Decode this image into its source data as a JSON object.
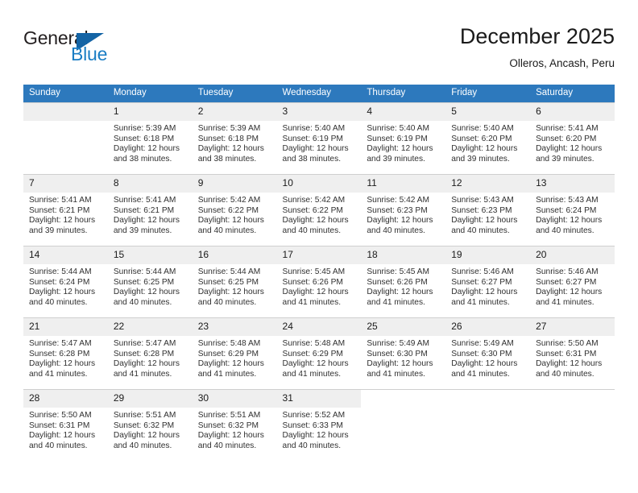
{
  "brand": {
    "name_part1": "General",
    "name_part2": "Blue",
    "triangle_icon": "triangle-icon",
    "colors": {
      "dark": "#231f20",
      "blue": "#1a7dc4",
      "triangle": "#1464a5"
    }
  },
  "header": {
    "title": "December 2025",
    "subtitle": "Olleros, Ancash, Peru"
  },
  "calendar": {
    "header_bg": "#2d79bd",
    "daynum_bg": "#efefef",
    "weekdays": [
      "Sunday",
      "Monday",
      "Tuesday",
      "Wednesday",
      "Thursday",
      "Friday",
      "Saturday"
    ],
    "weeks": [
      [
        {
          "day": "",
          "sunrise": "",
          "sunset": "",
          "daylight1": "",
          "daylight2": ""
        },
        {
          "day": "1",
          "sunrise": "Sunrise: 5:39 AM",
          "sunset": "Sunset: 6:18 PM",
          "daylight1": "Daylight: 12 hours",
          "daylight2": "and 38 minutes."
        },
        {
          "day": "2",
          "sunrise": "Sunrise: 5:39 AM",
          "sunset": "Sunset: 6:18 PM",
          "daylight1": "Daylight: 12 hours",
          "daylight2": "and 38 minutes."
        },
        {
          "day": "3",
          "sunrise": "Sunrise: 5:40 AM",
          "sunset": "Sunset: 6:19 PM",
          "daylight1": "Daylight: 12 hours",
          "daylight2": "and 38 minutes."
        },
        {
          "day": "4",
          "sunrise": "Sunrise: 5:40 AM",
          "sunset": "Sunset: 6:19 PM",
          "daylight1": "Daylight: 12 hours",
          "daylight2": "and 39 minutes."
        },
        {
          "day": "5",
          "sunrise": "Sunrise: 5:40 AM",
          "sunset": "Sunset: 6:20 PM",
          "daylight1": "Daylight: 12 hours",
          "daylight2": "and 39 minutes."
        },
        {
          "day": "6",
          "sunrise": "Sunrise: 5:41 AM",
          "sunset": "Sunset: 6:20 PM",
          "daylight1": "Daylight: 12 hours",
          "daylight2": "and 39 minutes."
        }
      ],
      [
        {
          "day": "7",
          "sunrise": "Sunrise: 5:41 AM",
          "sunset": "Sunset: 6:21 PM",
          "daylight1": "Daylight: 12 hours",
          "daylight2": "and 39 minutes."
        },
        {
          "day": "8",
          "sunrise": "Sunrise: 5:41 AM",
          "sunset": "Sunset: 6:21 PM",
          "daylight1": "Daylight: 12 hours",
          "daylight2": "and 39 minutes."
        },
        {
          "day": "9",
          "sunrise": "Sunrise: 5:42 AM",
          "sunset": "Sunset: 6:22 PM",
          "daylight1": "Daylight: 12 hours",
          "daylight2": "and 40 minutes."
        },
        {
          "day": "10",
          "sunrise": "Sunrise: 5:42 AM",
          "sunset": "Sunset: 6:22 PM",
          "daylight1": "Daylight: 12 hours",
          "daylight2": "and 40 minutes."
        },
        {
          "day": "11",
          "sunrise": "Sunrise: 5:42 AM",
          "sunset": "Sunset: 6:23 PM",
          "daylight1": "Daylight: 12 hours",
          "daylight2": "and 40 minutes."
        },
        {
          "day": "12",
          "sunrise": "Sunrise: 5:43 AM",
          "sunset": "Sunset: 6:23 PM",
          "daylight1": "Daylight: 12 hours",
          "daylight2": "and 40 minutes."
        },
        {
          "day": "13",
          "sunrise": "Sunrise: 5:43 AM",
          "sunset": "Sunset: 6:24 PM",
          "daylight1": "Daylight: 12 hours",
          "daylight2": "and 40 minutes."
        }
      ],
      [
        {
          "day": "14",
          "sunrise": "Sunrise: 5:44 AM",
          "sunset": "Sunset: 6:24 PM",
          "daylight1": "Daylight: 12 hours",
          "daylight2": "and 40 minutes."
        },
        {
          "day": "15",
          "sunrise": "Sunrise: 5:44 AM",
          "sunset": "Sunset: 6:25 PM",
          "daylight1": "Daylight: 12 hours",
          "daylight2": "and 40 minutes."
        },
        {
          "day": "16",
          "sunrise": "Sunrise: 5:44 AM",
          "sunset": "Sunset: 6:25 PM",
          "daylight1": "Daylight: 12 hours",
          "daylight2": "and 40 minutes."
        },
        {
          "day": "17",
          "sunrise": "Sunrise: 5:45 AM",
          "sunset": "Sunset: 6:26 PM",
          "daylight1": "Daylight: 12 hours",
          "daylight2": "and 41 minutes."
        },
        {
          "day": "18",
          "sunrise": "Sunrise: 5:45 AM",
          "sunset": "Sunset: 6:26 PM",
          "daylight1": "Daylight: 12 hours",
          "daylight2": "and 41 minutes."
        },
        {
          "day": "19",
          "sunrise": "Sunrise: 5:46 AM",
          "sunset": "Sunset: 6:27 PM",
          "daylight1": "Daylight: 12 hours",
          "daylight2": "and 41 minutes."
        },
        {
          "day": "20",
          "sunrise": "Sunrise: 5:46 AM",
          "sunset": "Sunset: 6:27 PM",
          "daylight1": "Daylight: 12 hours",
          "daylight2": "and 41 minutes."
        }
      ],
      [
        {
          "day": "21",
          "sunrise": "Sunrise: 5:47 AM",
          "sunset": "Sunset: 6:28 PM",
          "daylight1": "Daylight: 12 hours",
          "daylight2": "and 41 minutes."
        },
        {
          "day": "22",
          "sunrise": "Sunrise: 5:47 AM",
          "sunset": "Sunset: 6:28 PM",
          "daylight1": "Daylight: 12 hours",
          "daylight2": "and 41 minutes."
        },
        {
          "day": "23",
          "sunrise": "Sunrise: 5:48 AM",
          "sunset": "Sunset: 6:29 PM",
          "daylight1": "Daylight: 12 hours",
          "daylight2": "and 41 minutes."
        },
        {
          "day": "24",
          "sunrise": "Sunrise: 5:48 AM",
          "sunset": "Sunset: 6:29 PM",
          "daylight1": "Daylight: 12 hours",
          "daylight2": "and 41 minutes."
        },
        {
          "day": "25",
          "sunrise": "Sunrise: 5:49 AM",
          "sunset": "Sunset: 6:30 PM",
          "daylight1": "Daylight: 12 hours",
          "daylight2": "and 41 minutes."
        },
        {
          "day": "26",
          "sunrise": "Sunrise: 5:49 AM",
          "sunset": "Sunset: 6:30 PM",
          "daylight1": "Daylight: 12 hours",
          "daylight2": "and 41 minutes."
        },
        {
          "day": "27",
          "sunrise": "Sunrise: 5:50 AM",
          "sunset": "Sunset: 6:31 PM",
          "daylight1": "Daylight: 12 hours",
          "daylight2": "and 40 minutes."
        }
      ],
      [
        {
          "day": "28",
          "sunrise": "Sunrise: 5:50 AM",
          "sunset": "Sunset: 6:31 PM",
          "daylight1": "Daylight: 12 hours",
          "daylight2": "and 40 minutes."
        },
        {
          "day": "29",
          "sunrise": "Sunrise: 5:51 AM",
          "sunset": "Sunset: 6:32 PM",
          "daylight1": "Daylight: 12 hours",
          "daylight2": "and 40 minutes."
        },
        {
          "day": "30",
          "sunrise": "Sunrise: 5:51 AM",
          "sunset": "Sunset: 6:32 PM",
          "daylight1": "Daylight: 12 hours",
          "daylight2": "and 40 minutes."
        },
        {
          "day": "31",
          "sunrise": "Sunrise: 5:52 AM",
          "sunset": "Sunset: 6:33 PM",
          "daylight1": "Daylight: 12 hours",
          "daylight2": "and 40 minutes."
        },
        {
          "day": "",
          "sunrise": "",
          "sunset": "",
          "daylight1": "",
          "daylight2": ""
        },
        {
          "day": "",
          "sunrise": "",
          "sunset": "",
          "daylight1": "",
          "daylight2": ""
        },
        {
          "day": "",
          "sunrise": "",
          "sunset": "",
          "daylight1": "",
          "daylight2": ""
        }
      ]
    ]
  }
}
